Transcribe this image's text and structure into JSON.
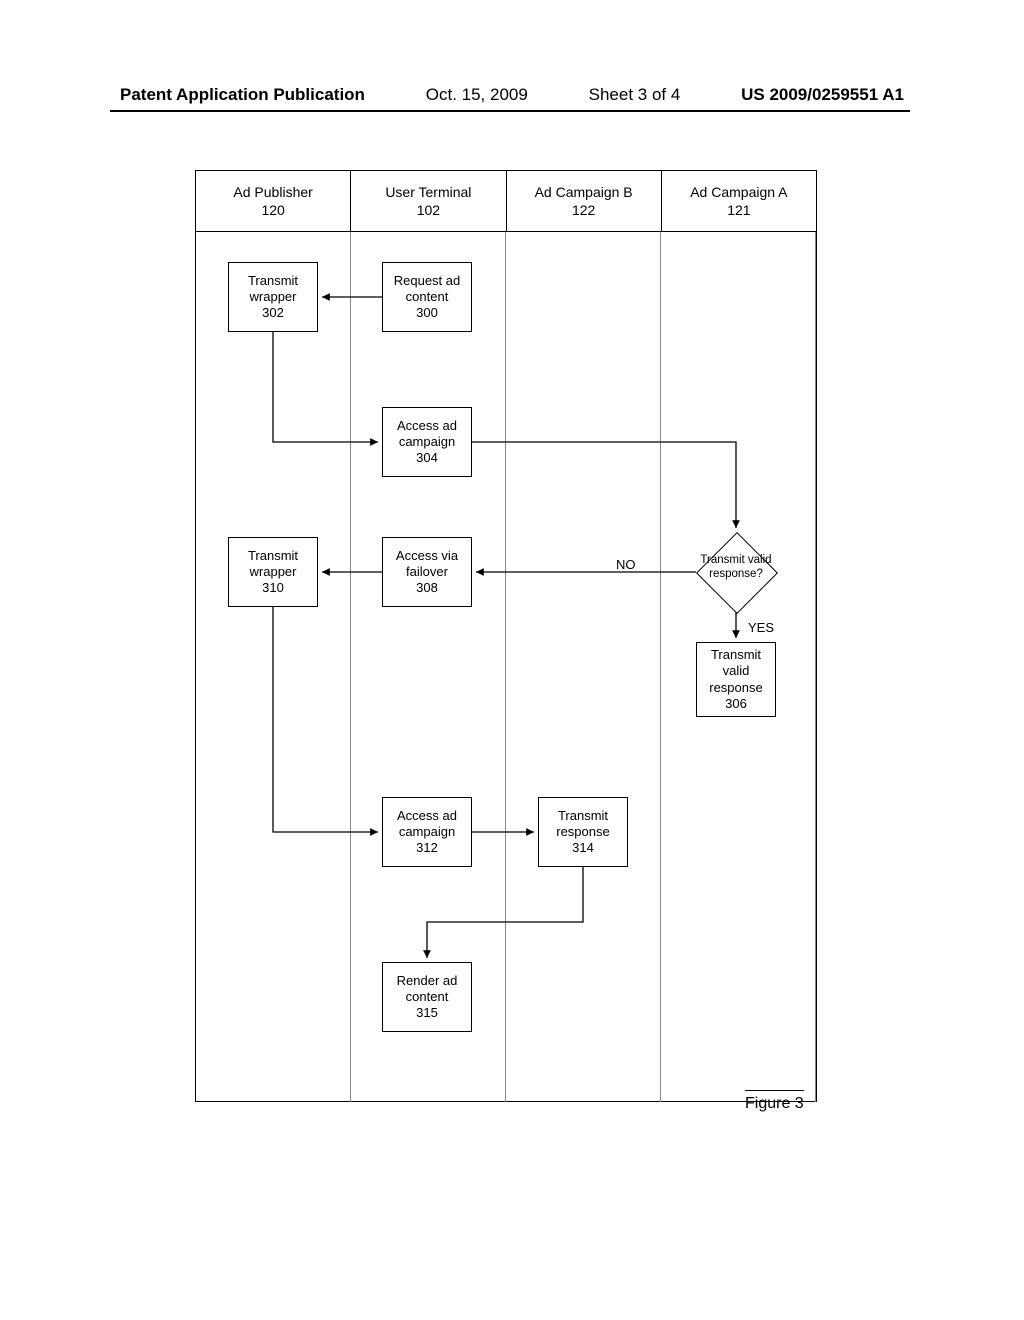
{
  "header": {
    "publication_label": "Patent Application Publication",
    "date": "Oct. 15, 2009",
    "sheet": "Sheet 3 of 4",
    "docno": "US 2009/0259551 A1"
  },
  "figure_label": "Figure 3",
  "lanes": {
    "l1": {
      "title": "Ad Publisher",
      "num": "120"
    },
    "l2": {
      "title": "User Terminal",
      "num": "102"
    },
    "l3": {
      "title": "Ad Campaign B",
      "num": "122"
    },
    "l4": {
      "title": "Ad Campaign A",
      "num": "121"
    }
  },
  "boxes": {
    "b300": {
      "text": "Request ad content",
      "num": "300"
    },
    "b302": {
      "text": "Transmit wrapper",
      "num": "302"
    },
    "b304": {
      "text": "Access ad campaign",
      "num": "304"
    },
    "decision": {
      "text": "Transmit valid response?",
      "yes": "YES",
      "no": "NO"
    },
    "b306": {
      "text": "Transmit valid response",
      "num": "306"
    },
    "b308": {
      "text": "Access via failover",
      "num": "308"
    },
    "b310": {
      "text": "Transmit wrapper",
      "num": "310"
    },
    "b312": {
      "text": "Access ad campaign",
      "num": "312"
    },
    "b314": {
      "text": "Transmit response",
      "num": "314"
    },
    "b315": {
      "text": "Render ad content",
      "num": "315"
    }
  }
}
